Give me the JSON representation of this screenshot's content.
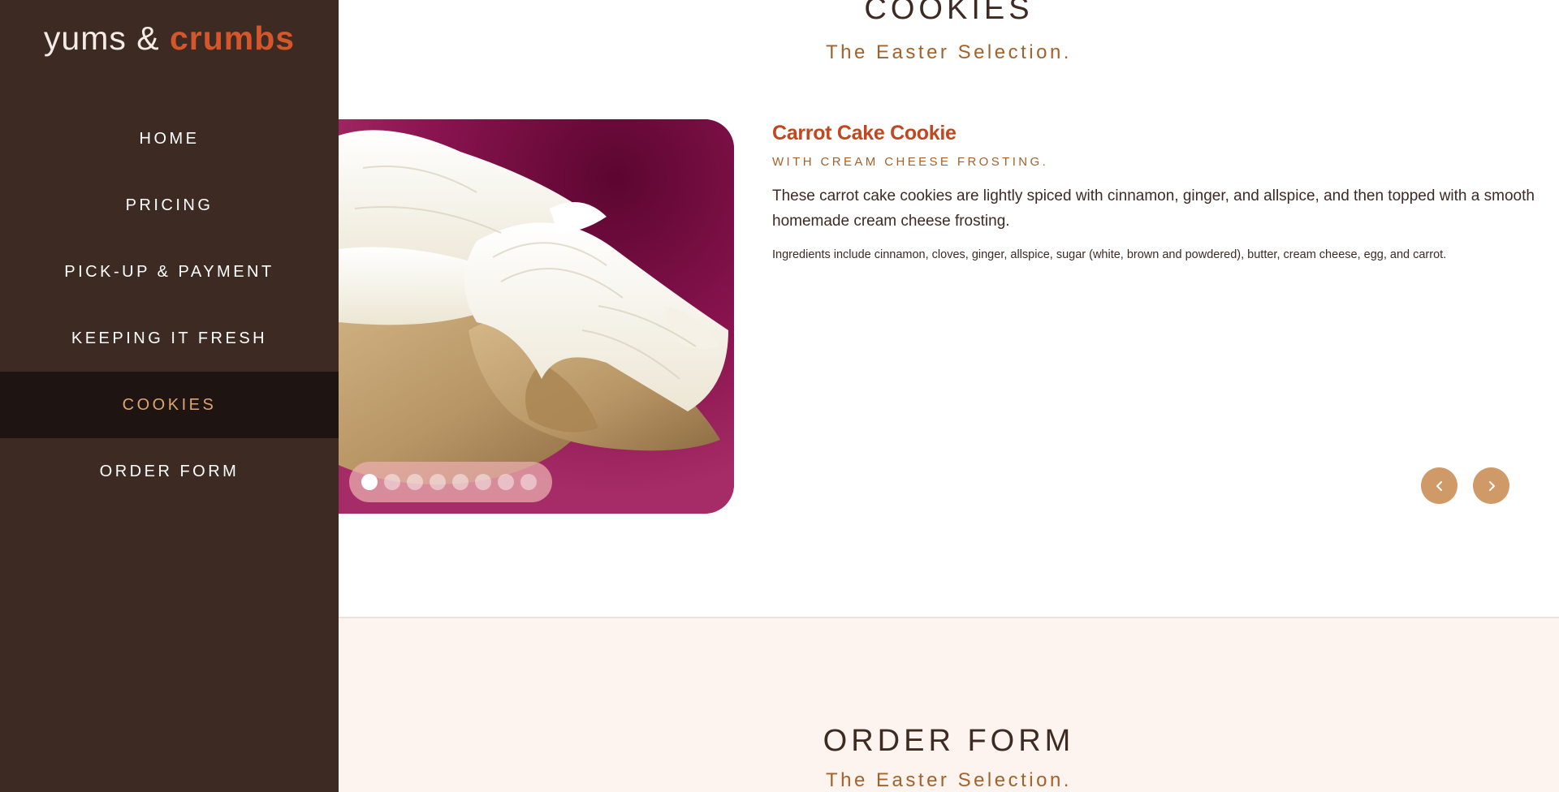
{
  "brand": {
    "name_part1": "yums & ",
    "name_part2": "crumbs"
  },
  "nav": {
    "items": [
      {
        "label": "HOME",
        "active": false
      },
      {
        "label": "PRICING",
        "active": false
      },
      {
        "label": "PICK-UP & PAYMENT",
        "active": false
      },
      {
        "label": "KEEPING IT FRESH",
        "active": false
      },
      {
        "label": "COOKIES",
        "active": true
      },
      {
        "label": "ORDER FORM",
        "active": false
      }
    ]
  },
  "cookies_section": {
    "title": "COOKIES",
    "subtitle": "The Easter Selection.",
    "carousel": {
      "slide_count": 8,
      "active_index": 0,
      "image": "frosted-cookie-photo"
    },
    "product": {
      "name": "Carrot Cake Cookie",
      "tagline": "WITH CREAM CHEESE FROSTING.",
      "description": "These carrot cake cookies are lightly spiced with cinnamon, ginger, and allspice, and then topped with a smooth homemade cream cheese frosting.",
      "ingredients": "Ingredients include cinnamon, cloves, ginger, allspice, sugar (white, brown and powdered), butter, cream cheese, egg, and carrot."
    },
    "controls": {
      "prev_icon": "chevron-left-icon",
      "next_icon": "chevron-right-icon"
    }
  },
  "order_section": {
    "title": "ORDER FORM",
    "subtitle": "The Easter Selection."
  },
  "colors": {
    "sidebar_bg": "#3d2a23",
    "sidebar_active_bg": "#1e1411",
    "accent_orange": "#d3572b",
    "accent_gold": "#e0a56d",
    "subtitle_brown": "#a3622b",
    "arrow_bg": "#cf9a68",
    "order_band_bg": "#fdf4ef"
  }
}
